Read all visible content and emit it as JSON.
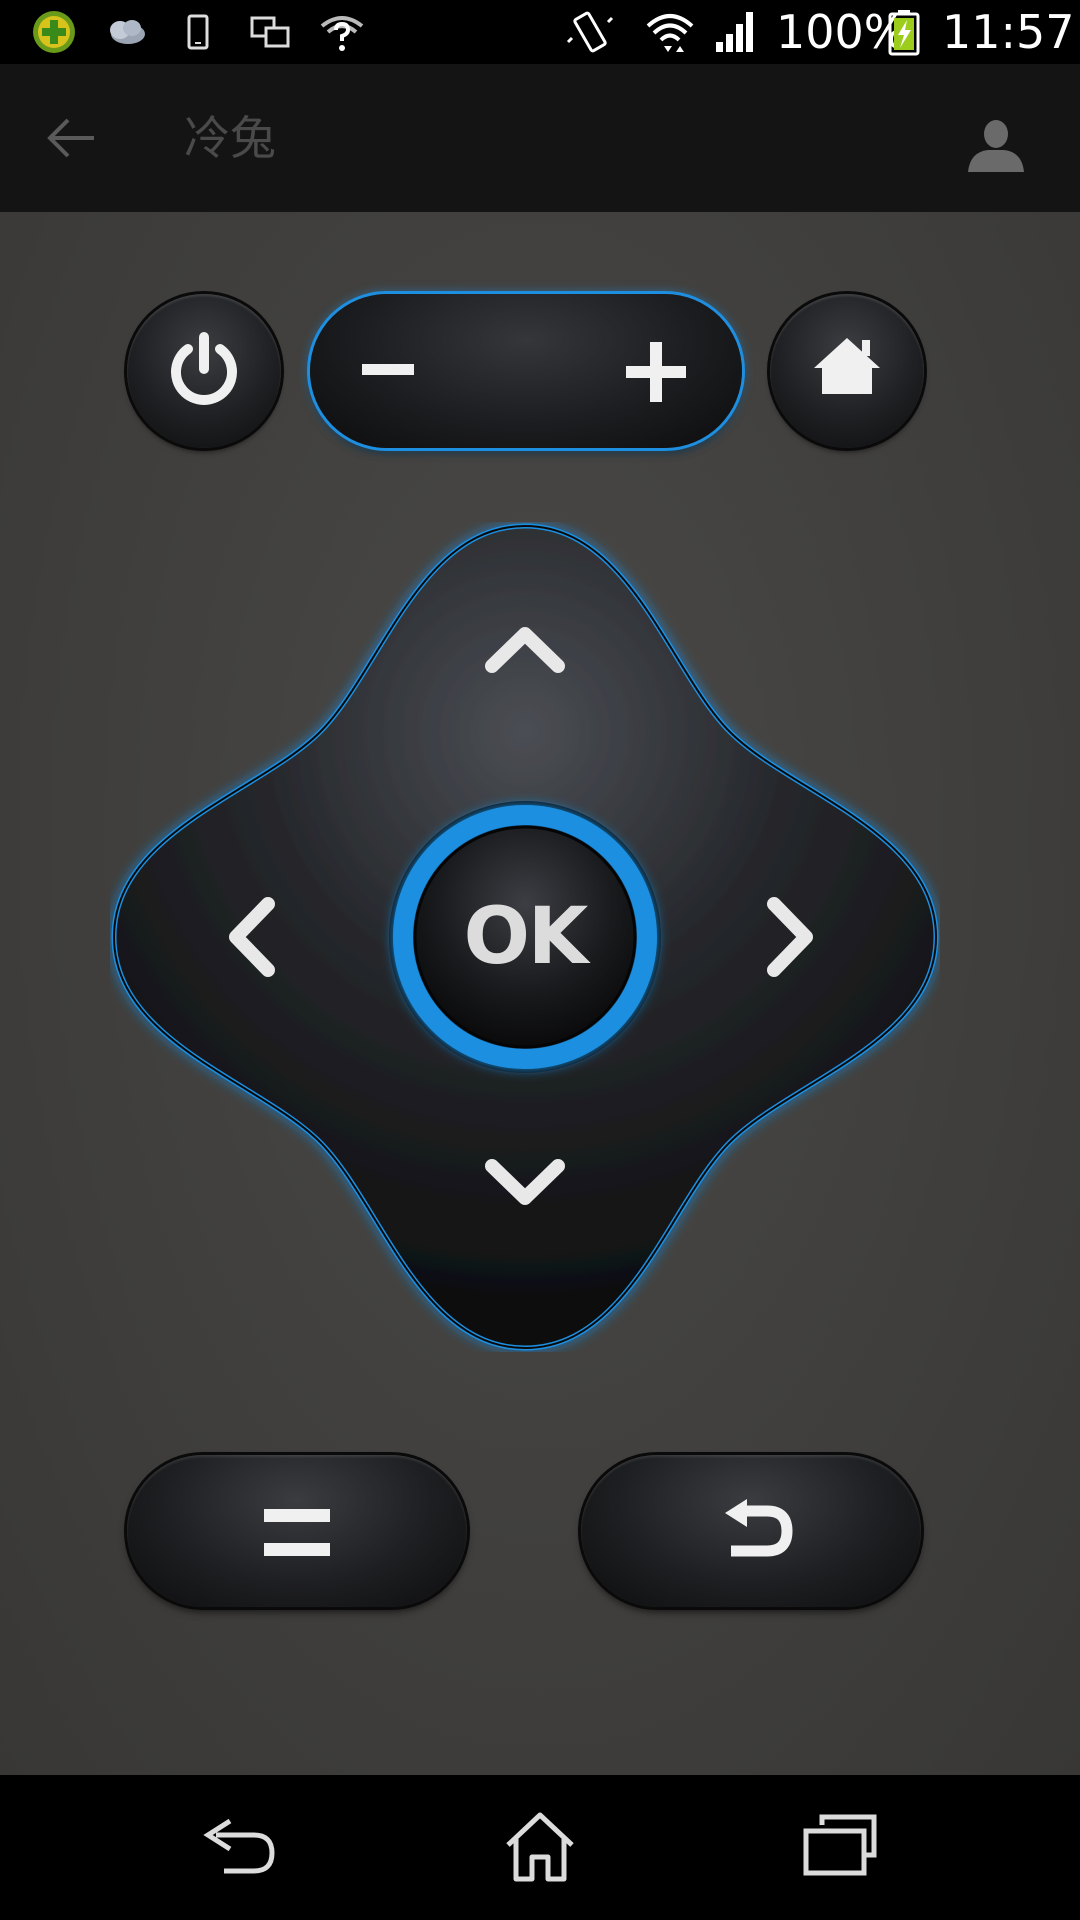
{
  "status_bar": {
    "battery_percent": "100%",
    "time": "11:57",
    "icons": [
      "app-360-icon",
      "cloud-weather-icon",
      "phone-outline-icon",
      "screen-mirror-icon",
      "wifi-question-icon",
      "vibrate-icon",
      "wifi-icon",
      "signal-icon",
      "battery-charging-icon"
    ]
  },
  "action_bar": {
    "title": "冷兔",
    "back_icon": "arrow-left-icon",
    "profile_icon": "person-icon"
  },
  "remote": {
    "power_icon": "power-icon",
    "volume_down_icon": "minus-icon",
    "volume_up_icon": "plus-icon",
    "home_icon": "home-icon",
    "dpad": {
      "up_icon": "chevron-up-icon",
      "down_icon": "chevron-down-icon",
      "left_icon": "chevron-left-icon",
      "right_icon": "chevron-right-icon",
      "ok_label": "OK"
    },
    "menu_icon": "menu-icon",
    "return_icon": "return-icon"
  },
  "nav_bar": {
    "icons": [
      "back-icon",
      "home-icon",
      "recents-icon"
    ]
  },
  "colors": {
    "accent_blue": "#1e8fe0",
    "background": "#403f3d",
    "action_bar": "#141414",
    "icon_light": "#e8e8e8"
  }
}
